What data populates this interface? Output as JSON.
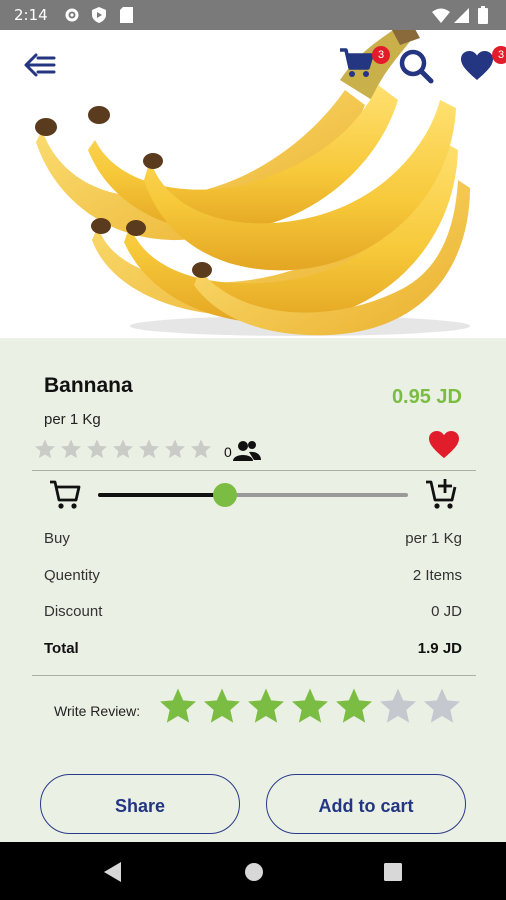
{
  "status_bar": {
    "time": "2:14"
  },
  "header": {
    "cart_count": "3",
    "wishlist_count": "3"
  },
  "product": {
    "name": "Bannana",
    "unit": "per 1 Kg",
    "price": "0.95 JD",
    "rating_count": "0",
    "rating_stars": 0,
    "rating_max": 7
  },
  "quantity_slider": {
    "value_fraction": 0.41
  },
  "summary": [
    {
      "label": "Buy",
      "value": "per 1 Kg"
    },
    {
      "label": "Quentity",
      "value": "2 Items"
    },
    {
      "label": "Discount",
      "value": "0 JD"
    },
    {
      "label": "Total",
      "value": "1.9 JD"
    }
  ],
  "review": {
    "label": "Write Review:",
    "stars_filled": 5,
    "stars_total": 7
  },
  "buttons": {
    "share": "Share",
    "add_to_cart": "Add to cart"
  },
  "colors": {
    "accent_green": "#7bbd42",
    "navy": "#243582",
    "heart_red": "#e21d2b",
    "background": "#eaf0e4"
  }
}
